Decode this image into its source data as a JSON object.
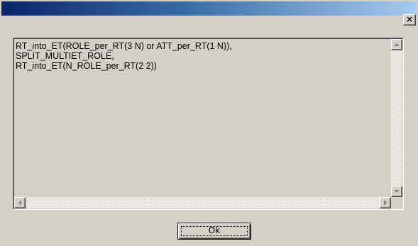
{
  "titlebar": {
    "title": "",
    "close_glyph": "×",
    "gradient_colors": [
      "#0a246a",
      "#3a6ea5",
      "#a6caf0"
    ]
  },
  "message": {
    "text": "RT_into_ET(ROLE_per_RT(3 N) or ATT_per_RT(1 N)),\nSPLIT_MULTIET_ROLE,\nRT_into_ET(N_ROLE_per_RT(2 2))"
  },
  "icons": {
    "scroll_up": "arrow-up-icon",
    "scroll_down": "arrow-down-icon",
    "scroll_left": "arrow-left-icon",
    "scroll_right": "arrow-right-icon"
  },
  "buttons": {
    "ok_label": "Ok"
  }
}
